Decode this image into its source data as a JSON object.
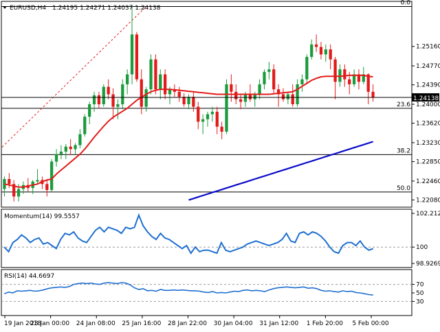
{
  "header": {
    "symbol": "EURUSD,H4",
    "ohlc": "1.24195 1.24271 1.24037 1.24138"
  },
  "colors": {
    "bull": "#1a9b3c",
    "bear": "#e21a1a",
    "ma_fast": "#e21a1a",
    "ma_slow": "#0a0ac8",
    "momentum": "#1e6fd0",
    "rsi": "#1e6fd0",
    "fib": "#000000",
    "trend": "#e21a1a",
    "last_price_bg": "#000000"
  },
  "chart_data": [
    {
      "type": "candlestick",
      "title": "EURUSD,H4",
      "last_price": "1.24138",
      "ylim": [
        1.2195,
        1.2605
      ],
      "y_ticks": [
        "1.25160",
        "1.24770",
        "1.24390",
        "1.24000",
        "1.23620",
        "1.23230",
        "1.22850",
        "1.22460",
        "1.22080"
      ],
      "x_ticks": [
        "19 Jan 2018",
        "23 Jan 00:00",
        "24 Jan 08:00",
        "25 Jan 16:00",
        "28 Jan 22:00",
        "30 Jan 04:00",
        "31 Jan 12:00",
        "1 Feb 20:00",
        "5 Feb 00:00"
      ],
      "fib_levels": [
        {
          "label": "0.0",
          "value": 1.2596
        },
        {
          "label": "23.6",
          "value": 1.2392
        },
        {
          "label": "38.2",
          "value": 1.2299
        },
        {
          "label": "50.0",
          "value": 1.2224
        }
      ],
      "trendline": {
        "from": [
          0,
          1.2314
        ],
        "to": [
          30,
          1.2596
        ]
      },
      "candles": [
        [
          1.223,
          1.2255,
          1.2215,
          1.225
        ],
        [
          1.225,
          1.2262,
          1.2232,
          1.224
        ],
        [
          1.224,
          1.2248,
          1.2205,
          1.2215
        ],
        [
          1.2215,
          1.224,
          1.2205,
          1.223
        ],
        [
          1.223,
          1.2245,
          1.222,
          1.2238
        ],
        [
          1.2238,
          1.2252,
          1.2225,
          1.2232
        ],
        [
          1.2232,
          1.2248,
          1.222,
          1.2245
        ],
        [
          1.2245,
          1.227,
          1.224,
          1.2248
        ],
        [
          1.2248,
          1.2255,
          1.223,
          1.224
        ],
        [
          1.224,
          1.225,
          1.2215,
          1.2228
        ],
        [
          1.2228,
          1.229,
          1.2225,
          1.2285
        ],
        [
          1.2285,
          1.231,
          1.2275,
          1.23
        ],
        [
          1.23,
          1.2318,
          1.229,
          1.2305
        ],
        [
          1.2305,
          1.232,
          1.229,
          1.2315
        ],
        [
          1.2315,
          1.233,
          1.2298,
          1.231
        ],
        [
          1.231,
          1.2322,
          1.23,
          1.2318
        ],
        [
          1.2318,
          1.235,
          1.2312,
          1.234
        ],
        [
          1.234,
          1.238,
          1.2335,
          1.2375
        ],
        [
          1.2375,
          1.2405,
          1.236,
          1.24
        ],
        [
          1.24,
          1.2425,
          1.2385,
          1.2418
        ],
        [
          1.2418,
          1.2425,
          1.2392,
          1.24
        ],
        [
          1.24,
          1.244,
          1.2395,
          1.2435
        ],
        [
          1.2435,
          1.245,
          1.241,
          1.242
        ],
        [
          1.242,
          1.2432,
          1.237,
          1.2395
        ],
        [
          1.2395,
          1.241,
          1.237,
          1.24
        ],
        [
          1.24,
          1.245,
          1.239,
          1.244
        ],
        [
          1.244,
          1.247,
          1.242,
          1.246
        ],
        [
          1.246,
          1.26,
          1.244,
          1.254
        ],
        [
          1.254,
          1.2545,
          1.2445,
          1.245
        ],
        [
          1.245,
          1.247,
          1.238,
          1.2395
        ],
        [
          1.2395,
          1.2435,
          1.2385,
          1.243
        ],
        [
          1.243,
          1.25,
          1.242,
          1.249
        ],
        [
          1.249,
          1.25,
          1.242,
          1.243
        ],
        [
          1.243,
          1.247,
          1.241,
          1.246
        ],
        [
          1.246,
          1.247,
          1.241,
          1.242
        ],
        [
          1.242,
          1.2435,
          1.24,
          1.243
        ],
        [
          1.243,
          1.244,
          1.2415,
          1.2425
        ],
        [
          1.2425,
          1.2435,
          1.2405,
          1.2415
        ],
        [
          1.2415,
          1.2422,
          1.2395,
          1.24
        ],
        [
          1.24,
          1.242,
          1.239,
          1.2415
        ],
        [
          1.2415,
          1.2425,
          1.2385,
          1.2395
        ],
        [
          1.2395,
          1.2405,
          1.235,
          1.2365
        ],
        [
          1.2365,
          1.238,
          1.234,
          1.237
        ],
        [
          1.237,
          1.2385,
          1.2355,
          1.238
        ],
        [
          1.238,
          1.2395,
          1.2365,
          1.2385
        ],
        [
          1.2385,
          1.2395,
          1.234,
          1.2355
        ],
        [
          1.2355,
          1.2365,
          1.233,
          1.2345
        ],
        [
          1.2345,
          1.245,
          1.234,
          1.244
        ],
        [
          1.244,
          1.246,
          1.2405,
          1.2425
        ],
        [
          1.2425,
          1.244,
          1.24,
          1.241
        ],
        [
          1.241,
          1.242,
          1.239,
          1.2405
        ],
        [
          1.2405,
          1.2425,
          1.2395,
          1.242
        ],
        [
          1.242,
          1.244,
          1.2405,
          1.241
        ],
        [
          1.241,
          1.2425,
          1.2395,
          1.242
        ],
        [
          1.242,
          1.245,
          1.241,
          1.244
        ],
        [
          1.244,
          1.247,
          1.243,
          1.2465
        ],
        [
          1.2465,
          1.2485,
          1.245,
          1.247
        ],
        [
          1.247,
          1.248,
          1.242,
          1.243
        ],
        [
          1.243,
          1.244,
          1.2395,
          1.242
        ],
        [
          1.242,
          1.2432,
          1.2405,
          1.241
        ],
        [
          1.241,
          1.2425,
          1.24,
          1.242
        ],
        [
          1.242,
          1.244,
          1.2395,
          1.24
        ],
        [
          1.24,
          1.245,
          1.2395,
          1.244
        ],
        [
          1.244,
          1.246,
          1.2425,
          1.245
        ],
        [
          1.245,
          1.25,
          1.244,
          1.2495
        ],
        [
          1.2495,
          1.253,
          1.249,
          1.252
        ],
        [
          1.252,
          1.254,
          1.2505,
          1.2515
        ],
        [
          1.2515,
          1.2525,
          1.249,
          1.25
        ],
        [
          1.25,
          1.252,
          1.2485,
          1.251
        ],
        [
          1.251,
          1.252,
          1.247,
          1.249
        ],
        [
          1.249,
          1.2495,
          1.241,
          1.2445
        ],
        [
          1.2445,
          1.248,
          1.2435,
          1.247
        ],
        [
          1.247,
          1.248,
          1.2435,
          1.245
        ],
        [
          1.245,
          1.2465,
          1.242,
          1.244
        ],
        [
          1.244,
          1.247,
          1.2435,
          1.246
        ],
        [
          1.246,
          1.247,
          1.243,
          1.2445
        ],
        [
          1.2445,
          1.2475,
          1.244,
          1.246
        ],
        [
          1.246,
          1.2462,
          1.24,
          1.2425
        ],
        [
          1.2425,
          1.244,
          1.2405,
          1.2414
        ]
      ],
      "ma_fast": [
        1.224,
        1.2238,
        1.2236,
        1.2234,
        1.2234,
        1.2236,
        1.2238,
        1.224,
        1.2245,
        1.2248,
        1.225,
        1.226,
        1.2268,
        1.2276,
        1.2284,
        1.2292,
        1.23,
        1.231,
        1.2322,
        1.2334,
        1.2345,
        1.2356,
        1.2366,
        1.2374,
        1.238,
        1.2386,
        1.2392,
        1.24,
        1.2408,
        1.2414,
        1.242,
        1.2425,
        1.2428,
        1.243,
        1.243,
        1.243,
        1.2429,
        1.2428,
        1.2427,
        1.2426,
        1.2425,
        1.2424,
        1.2423,
        1.2422,
        1.2421,
        1.242,
        1.242,
        1.242,
        1.242,
        1.242,
        1.242,
        1.242,
        1.242,
        1.242,
        1.242,
        1.242,
        1.242,
        1.2421,
        1.2422,
        1.2423,
        1.2424,
        1.2425,
        1.243,
        1.2436,
        1.2442,
        1.2448,
        1.2452,
        1.2455,
        1.2456,
        1.2456,
        1.2456,
        1.2456,
        1.2457,
        1.2458,
        1.2458,
        1.2458,
        1.2458,
        1.2456,
        1.2455
      ],
      "ma_slow": {
        "x_start": 39,
        "values": [
          1.2208,
          1.2211,
          1.2214,
          1.2217,
          1.222,
          1.2223,
          1.2226,
          1.2229,
          1.2232,
          1.2235,
          1.2238,
          1.2241,
          1.2244,
          1.2247,
          1.225,
          1.2253,
          1.2256,
          1.2259,
          1.2262,
          1.2265,
          1.2268,
          1.2271,
          1.2274,
          1.2277,
          1.228,
          1.2283,
          1.2286,
          1.2289,
          1.2292,
          1.2295,
          1.2298,
          1.2301,
          1.2304,
          1.2307,
          1.231,
          1.2313,
          1.2316,
          1.2319,
          1.2322,
          1.2325
        ]
      }
    },
    {
      "type": "line",
      "title": "Momentum(14) 99.5557",
      "ylim": [
        98.75,
        102.35
      ],
      "y_ticks": [
        "102.212",
        "100",
        "98.9269"
      ],
      "level": 100,
      "values": [
        100.0,
        99.7,
        100.3,
        100.5,
        100.8,
        100.6,
        100.3,
        100.5,
        100.6,
        100.2,
        100.3,
        100.1,
        99.9,
        100.5,
        100.9,
        100.8,
        101.0,
        100.6,
        100.4,
        100.3,
        100.7,
        101.1,
        101.3,
        101.0,
        101.3,
        101.2,
        101.1,
        100.9,
        101.3,
        101.2,
        101.3,
        102.1,
        101.4,
        101.0,
        100.7,
        100.5,
        100.9,
        100.6,
        100.5,
        100.3,
        100.1,
        99.9,
        100.1,
        99.6,
        100.0,
        99.7,
        99.8,
        99.8,
        99.7,
        99.6,
        100.3,
        99.8,
        99.7,
        99.8,
        99.9,
        100.0,
        100.2,
        100.3,
        100.4,
        100.3,
        100.2,
        100.1,
        100.2,
        100.3,
        100.5,
        100.9,
        100.4,
        100.3,
        100.9,
        101.0,
        100.8,
        101.0,
        100.9,
        100.7,
        100.4,
        100.0,
        99.7,
        99.6,
        100.1,
        100.3,
        100.3,
        100.1,
        100.4,
        100.0,
        99.8,
        99.9
      ]
    },
    {
      "type": "line",
      "title": "RSI(14) 44.6697",
      "ylim": [
        0,
        100
      ],
      "y_ticks": [
        "70",
        "50",
        "30"
      ],
      "levels": [
        70,
        30
      ],
      "values": [
        48,
        52,
        50,
        55,
        54,
        55,
        56,
        54,
        55,
        57,
        60,
        62,
        63,
        64,
        63,
        65,
        70,
        72,
        73,
        72,
        73,
        71,
        70,
        73,
        74,
        73,
        72,
        74,
        73,
        69,
        62,
        58,
        60,
        55,
        56,
        54,
        58,
        56,
        56,
        57,
        56,
        57,
        56,
        55,
        55,
        54,
        52,
        51,
        53,
        50,
        51,
        50,
        52,
        54,
        53,
        56,
        57,
        55,
        56,
        55,
        53,
        57,
        60,
        62,
        63,
        64,
        63,
        62,
        63,
        64,
        61,
        62,
        60,
        56,
        54,
        55,
        53,
        52,
        55,
        53,
        54,
        51,
        50,
        48,
        46,
        45
      ]
    }
  ]
}
